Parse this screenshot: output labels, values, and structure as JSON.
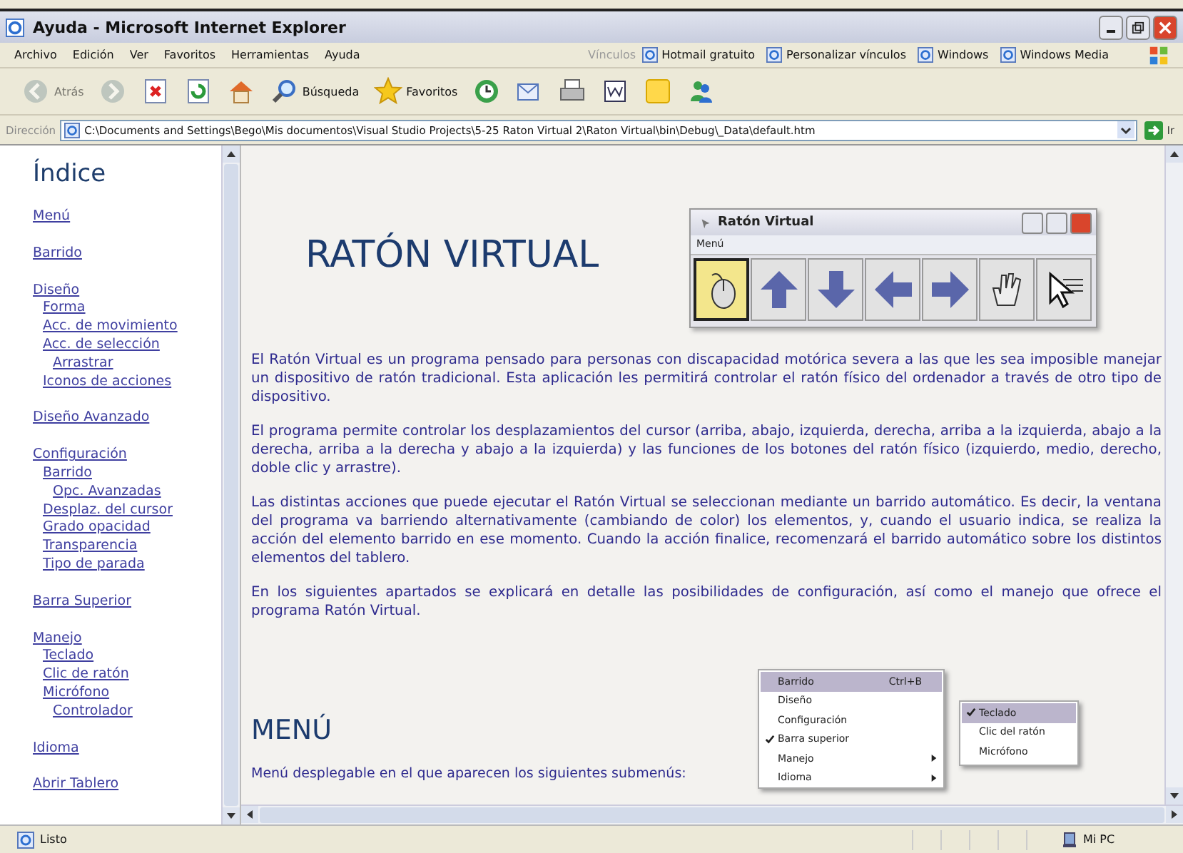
{
  "window": {
    "title": "Ayuda - Microsoft Internet Explorer"
  },
  "menu_bar": {
    "items": [
      "Archivo",
      "Edición",
      "Ver",
      "Favoritos",
      "Herramientas",
      "Ayuda"
    ],
    "links_label": "Vínculos",
    "links": [
      "Hotmail gratuito",
      "Personalizar vínculos",
      "Windows",
      "Windows Media"
    ]
  },
  "toolbar": {
    "buttons": [
      {
        "kind": "back",
        "label": "Atrás",
        "disabled": true
      },
      {
        "kind": "forward",
        "disabled": true
      },
      {
        "kind": "stop",
        "disabled": false
      },
      {
        "kind": "refresh",
        "disabled": false
      },
      {
        "kind": "home",
        "disabled": false
      },
      {
        "kind": "search",
        "label": "Búsqueda",
        "disabled": false
      },
      {
        "kind": "favorites",
        "label": "Favoritos",
        "disabled": false
      },
      {
        "kind": "history",
        "disabled": false
      },
      {
        "kind": "mail",
        "disabled": false
      },
      {
        "kind": "print",
        "disabled": false
      },
      {
        "kind": "edit",
        "disabled": false
      },
      {
        "kind": "note",
        "disabled": false
      },
      {
        "kind": "messenger",
        "disabled": false
      }
    ]
  },
  "address_bar": {
    "label": "Dirección",
    "url": "C:\\Documents and Settings\\Bego\\Mis documentos\\Visual Studio Projects\\5-25 Raton Virtual 2\\Raton Virtual\\bin\\Debug\\_Data\\default.htm",
    "go": "Ir"
  },
  "sidebar": {
    "heading": "Índice",
    "items": [
      {
        "label": "Menú"
      },
      {
        "label": "Barrido"
      },
      {
        "label": "Diseño",
        "children": [
          {
            "label": "Forma"
          },
          {
            "label": "Acc. de movimiento"
          },
          {
            "label": "Acc. de selección",
            "children": [
              {
                "label": "Arrastrar"
              }
            ]
          },
          {
            "label": "Iconos de acciones"
          }
        ]
      },
      {
        "label": "Diseño Avanzado"
      },
      {
        "label": "Configuración",
        "children": [
          {
            "label": "Barrido",
            "children": [
              {
                "label": "Opc. Avanzadas"
              }
            ]
          },
          {
            "label": "Desplaz. del cursor"
          },
          {
            "label": "Grado opacidad"
          },
          {
            "label": "Transparencia"
          },
          {
            "label": "Tipo de parada"
          }
        ]
      },
      {
        "label": "Barra Superior"
      },
      {
        "label": "Manejo",
        "children": [
          {
            "label": "Teclado"
          },
          {
            "label": "Clic de ratón"
          },
          {
            "label": "Micrófono",
            "children": [
              {
                "label": "Controlador"
              }
            ]
          }
        ]
      },
      {
        "label": "Idioma"
      },
      {
        "label": "Abrir Tablero"
      }
    ]
  },
  "content": {
    "title": "RATÓN VIRTUAL",
    "app_window": {
      "title": "Ratón Virtual",
      "menu": "Menú",
      "buttons": [
        {
          "kind": "mouse",
          "selected": true
        },
        {
          "kind": "up",
          "selected": false
        },
        {
          "kind": "down",
          "selected": false
        },
        {
          "kind": "left",
          "selected": false
        },
        {
          "kind": "right",
          "selected": false
        },
        {
          "kind": "hand",
          "selected": false
        },
        {
          "kind": "pointer",
          "selected": false
        }
      ]
    },
    "paragraphs": [
      "El Ratón Virtual es un programa pensado para personas con discapacidad motórica severa a las que les sea imposible manejar un dispositivo de ratón tradicional. Esta aplicación les permitirá controlar el ratón físico del ordenador a través de otro tipo de dispositivo.",
      "El programa permite controlar los desplazamientos del cursor (arriba, abajo, izquierda, derecha, arriba a la izquierda, abajo a la derecha, arriba a la derecha y abajo a la izquierda) y las funciones de los botones del ratón físico (izquierdo, medio, derecho, doble clic y arrastre).",
      "Las distintas acciones que puede ejecutar el Ratón Virtual se seleccionan mediante un barrido automático. Es decir, la ventana del programa va barriendo alternativamente (cambiando de color) los elementos, y, cuando el usuario indica, se realiza la acción del elemento barrido en ese momento. Cuando la acción finalice, recomenzará el barrido automático sobre los distintos elementos del tablero.",
      "En los siguientes apartados se explicará en detalle las posibilidades de configuración, así como el manejo que ofrece el programa Ratón Virtual."
    ],
    "section_title": "MENÚ",
    "section_intro": "Menú desplegable en el que aparecen los siguientes submenús:",
    "menu": [
      {
        "label": "Barrido",
        "shortcut": "Ctrl+B",
        "selected": true,
        "checked": false,
        "has_submenu": false
      },
      {
        "label": "Diseño",
        "selected": false,
        "checked": false,
        "has_submenu": false
      },
      {
        "label": "Configuración",
        "selected": false,
        "checked": false,
        "has_submenu": false
      },
      {
        "label": "Barra superior",
        "selected": false,
        "checked": true,
        "has_submenu": false
      },
      {
        "label": "Manejo",
        "selected": false,
        "checked": false,
        "has_submenu": true
      },
      {
        "label": "Idioma",
        "selected": false,
        "checked": false,
        "has_submenu": true
      }
    ],
    "submenu": [
      {
        "label": "Teclado",
        "selected": true,
        "checked": true
      },
      {
        "label": "Clic del ratón",
        "selected": false,
        "checked": false
      },
      {
        "label": "Micrófono",
        "selected": false,
        "checked": false
      }
    ]
  },
  "status_bar": {
    "text": "Listo",
    "zone": "Mi PC"
  }
}
